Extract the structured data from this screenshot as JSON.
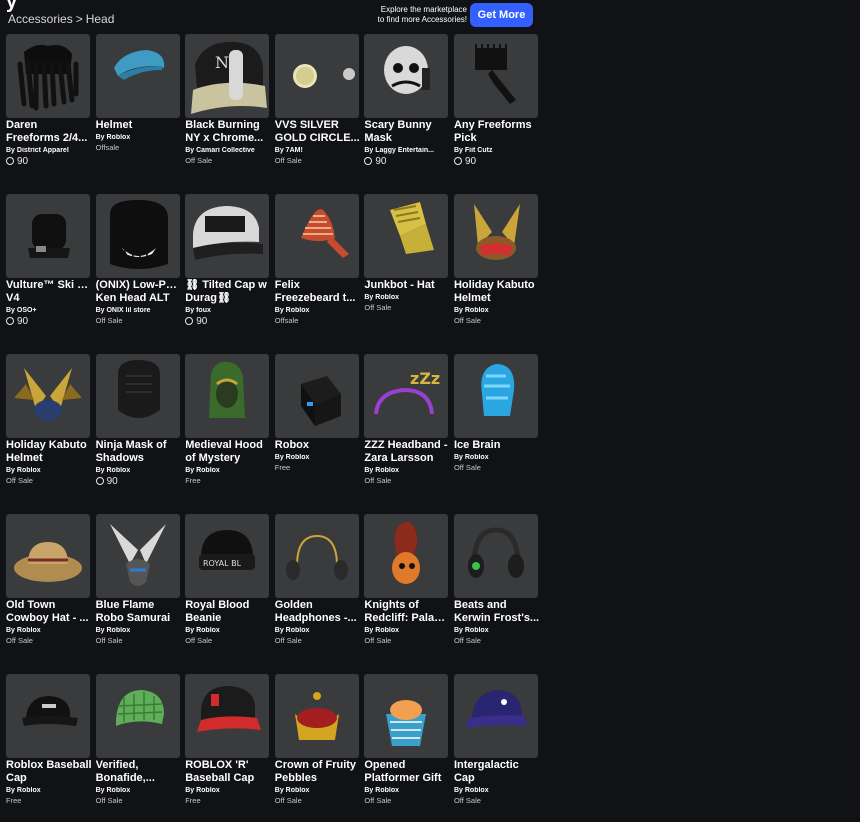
{
  "header": {
    "title_fragment": "y",
    "breadcrumb": [
      "Accessories",
      "Head"
    ],
    "breadcrumb_separator": ">",
    "promo_line1": "Explore the marketplace",
    "promo_line2": "to find more Accessories!",
    "get_more_label": "Get More",
    "accent_color": "#335fff"
  },
  "robux_icon": "robux-icon",
  "items": [
    {
      "name_line1": "Daren",
      "name_line2": "Freeforms 2/4...",
      "creator": "By District Apparel",
      "price": "90",
      "price_type": "robux"
    },
    {
      "name_line1": "Helmet",
      "name_line2": "",
      "creator": "By Roblox",
      "price": "Offsale",
      "price_type": "text"
    },
    {
      "name_line1": "Black Burning",
      "name_line2": "NY x Chrome...",
      "creator": "By Camari Collective",
      "price": "Off Sale",
      "price_type": "text"
    },
    {
      "name_line1": "VVS SILVER",
      "name_line2": "GOLD CIRCLE...",
      "creator": "By 7AM!",
      "price": "Off Sale",
      "price_type": "text"
    },
    {
      "name_line1": "Scary Bunny",
      "name_line2": "Mask",
      "creator": "By Laggy Entertain...",
      "price": "90",
      "price_type": "robux"
    },
    {
      "name_line1": "Any Freeforms",
      "name_line2": "Pick",
      "creator": "By Fiit Cutz",
      "price": "90",
      "price_type": "robux"
    },
    {
      "name_line1": "Vulture™ Ski Pro",
      "name_line2": "V4",
      "creator": "By OSO+",
      "price": "90",
      "price_type": "robux"
    },
    {
      "name_line1": "(ONIX) Low-Poly",
      "name_line2": "Ken Head ALT",
      "creator": "By ONIX lil store",
      "price": "Off Sale",
      "price_type": "text"
    },
    {
      "name_line1": "⛓ Tilted Cap w",
      "name_line2": "Durag⛓",
      "creator": "By foux",
      "price": "90",
      "price_type": "robux"
    },
    {
      "name_line1": "Felix",
      "name_line2": "Freezebeard t...",
      "creator": "By Roblox",
      "price": "Offsale",
      "price_type": "text"
    },
    {
      "name_line1": "Junkbot - Hat",
      "name_line2": "",
      "creator": "By Roblox",
      "price": "Off Sale",
      "price_type": "text"
    },
    {
      "name_line1": "Holiday Kabuto",
      "name_line2": "Helmet",
      "creator": "By Roblox",
      "price": "Off Sale",
      "price_type": "text"
    },
    {
      "name_line1": "Holiday Kabuto",
      "name_line2": "Helmet",
      "creator": "By Roblox",
      "price": "Off Sale",
      "price_type": "text"
    },
    {
      "name_line1": "Ninja Mask of",
      "name_line2": "Shadows",
      "creator": "By Roblox",
      "price": "90",
      "price_type": "robux"
    },
    {
      "name_line1": "Medieval Hood",
      "name_line2": "of Mystery",
      "creator": "By Roblox",
      "price": "Free",
      "price_type": "text"
    },
    {
      "name_line1": "Robox",
      "name_line2": "",
      "creator": "By Roblox",
      "price": "Free",
      "price_type": "text"
    },
    {
      "name_line1": "ZZZ Headband -",
      "name_line2": "Zara Larsson",
      "creator": "By Roblox",
      "price": "Off Sale",
      "price_type": "text"
    },
    {
      "name_line1": "Ice Brain",
      "name_line2": "",
      "creator": "By Roblox",
      "price": "Off Sale",
      "price_type": "text"
    },
    {
      "name_line1": "Old Town",
      "name_line2": "Cowboy Hat - ...",
      "creator": "By Roblox",
      "price": "Off Sale",
      "price_type": "text"
    },
    {
      "name_line1": "Blue Flame",
      "name_line2": "Robo Samurai",
      "creator": "By Roblox",
      "price": "Off Sale",
      "price_type": "text"
    },
    {
      "name_line1": "Royal Blood",
      "name_line2": "Beanie",
      "creator": "By Roblox",
      "price": "Off Sale",
      "price_type": "text"
    },
    {
      "name_line1": "Golden",
      "name_line2": "Headphones -...",
      "creator": "By Roblox",
      "price": "Off Sale",
      "price_type": "text"
    },
    {
      "name_line1": "Knights of",
      "name_line2": "Redcliff: Paladi...",
      "creator": "By Roblox",
      "price": "Off Sale",
      "price_type": "text"
    },
    {
      "name_line1": "Beats and",
      "name_line2": "Kerwin Frost's...",
      "creator": "By Roblox",
      "price": "Off Sale",
      "price_type": "text"
    },
    {
      "name_line1": "Roblox Baseball",
      "name_line2": "Cap",
      "creator": "By Roblox",
      "price": "Free",
      "price_type": "text"
    },
    {
      "name_line1": "Verified,",
      "name_line2": "Bonafide,...",
      "creator": "By Roblox",
      "price": "Off Sale",
      "price_type": "text"
    },
    {
      "name_line1": "ROBLOX 'R'",
      "name_line2": "Baseball Cap",
      "creator": "By Roblox",
      "price": "Free",
      "price_type": "text"
    },
    {
      "name_line1": "Crown of Fruity",
      "name_line2": "Pebbles",
      "creator": "By Roblox",
      "price": "Off Sale",
      "price_type": "text"
    },
    {
      "name_line1": "Opened",
      "name_line2": "Platformer Gift",
      "creator": "By Roblox",
      "price": "Off Sale",
      "price_type": "text"
    },
    {
      "name_line1": "Intergalactic",
      "name_line2": "Cap",
      "creator": "By Roblox",
      "price": "Off Sale",
      "price_type": "text"
    }
  ]
}
